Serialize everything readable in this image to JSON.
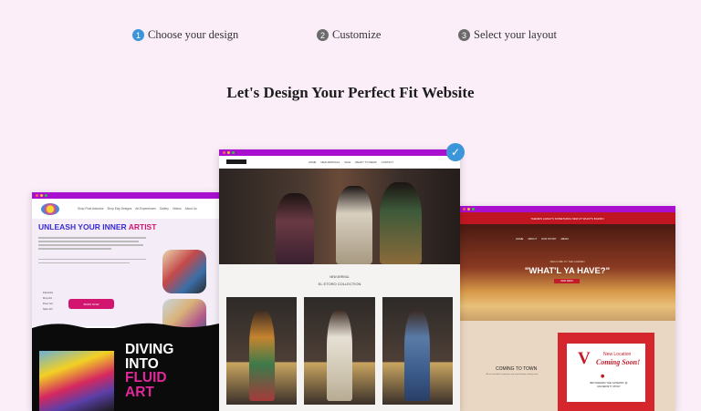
{
  "steps": [
    {
      "num": "1",
      "label": "Choose your design"
    },
    {
      "num": "2",
      "label": "Customize"
    },
    {
      "num": "3",
      "label": "Select your layout"
    }
  ],
  "headline": "Let's Design Your Perfect Fit Website",
  "colors": {
    "accent": "#3a95d9",
    "browser_chrome": "#a80fcf",
    "background": "#fbeef8"
  },
  "left_preview": {
    "nav_links": [
      "Shop Fluid Artworks",
      "Shop Eclp Designs",
      "Art Experiences",
      "Gallery",
      "Videos",
      "About Us"
    ],
    "headline_a": "UNLEASH YOUR INNER ",
    "headline_b": "ARTIST",
    "bullets": [
      "Fluid Art",
      "Drip Art",
      "Pour Art",
      "Spin Art"
    ],
    "book_button": "BOOK NOW",
    "diving_a": "DIVING",
    "diving_b": "INTO",
    "diving_c": "FLUID",
    "diving_d": "ART"
  },
  "center_preview": {
    "nav_links": [
      "HOME",
      "NEW ARRIVALS",
      "SALE",
      "READY TO WEAR",
      "CONTACT"
    ],
    "collection_kicker": "NEW ARRIVAL",
    "collection_title": "EL ETORO COLLECTION"
  },
  "right_preview": {
    "announcement": "THERE'S ALWAYS SOMETHING NEW AT WHAT'S BUZZIN",
    "nav_links": [
      "HOME",
      "ABOUT",
      "OUR STORY",
      "MENU"
    ],
    "welcome": "WELCOME TO THE GARDEN",
    "hero_title": "\"WHAT'L YA HAVE?\"",
    "menu_button": "VIEW MENU",
    "coming_title": "COMING TO TOWN",
    "coming_sub": "We are excited to announce our new location coming soon.",
    "sign_new_location": "New Location",
    "sign_coming_soon": "Coming Soon!",
    "sign_address": "BETHLEHEM THE GATEWAY @ UNIVERSITY PKWY"
  }
}
